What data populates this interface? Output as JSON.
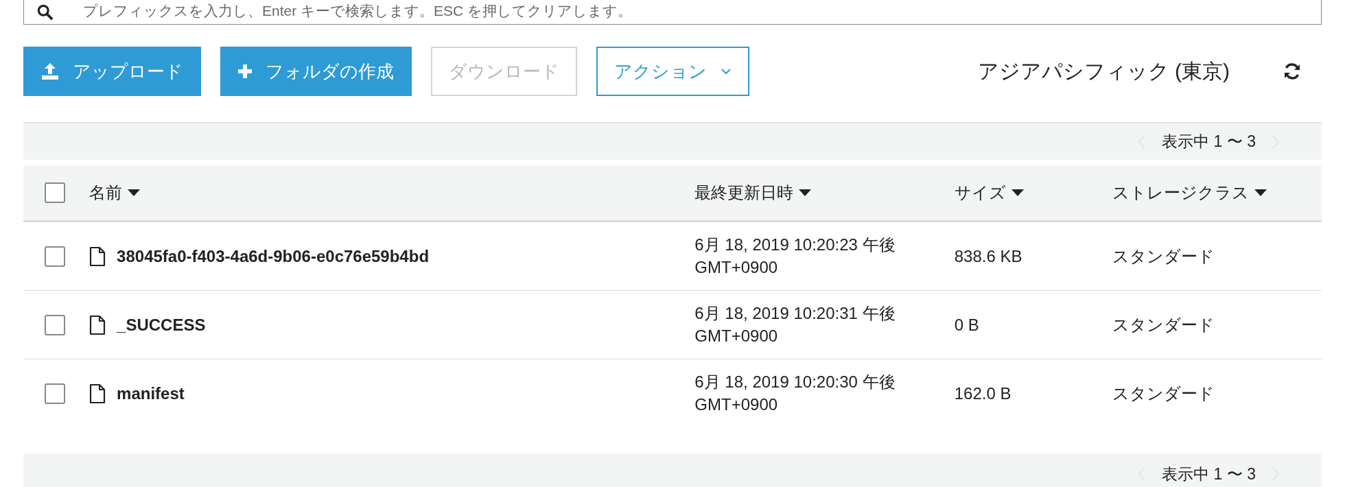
{
  "search": {
    "placeholder": "プレフィックスを入力し、Enter キーで検索します。ESC を押してクリアします。"
  },
  "toolbar": {
    "buttons": [
      {
        "label": "アップロード",
        "kind": "upload",
        "disabled": false
      },
      {
        "label": "フォルダの作成",
        "kind": "folder",
        "disabled": false
      },
      {
        "label": "ダウンロード",
        "kind": "plain",
        "disabled": true
      },
      {
        "label": "アクション",
        "kind": "dropdown",
        "disabled": false
      }
    ],
    "region": "アジアパシフィック (東京)"
  },
  "pagination_top": {
    "text": "表示中 1 〜 3"
  },
  "table": {
    "all_checked": false,
    "columns": [
      "名前",
      "最終更新日時",
      "サイズ",
      "ストレージクラス"
    ],
    "rows": [
      {
        "checked": false,
        "name": "38045fa0-f403-4a6d-9b06-e0c76e59b4bd",
        "modified": [
          "6月 18, 2019 10:20:23 午後",
          "GMT+0900"
        ],
        "size": "838.6 KB",
        "storage_class": "スタンダード"
      },
      {
        "checked": false,
        "name": "_SUCCESS",
        "modified": [
          "6月 18, 2019 10:20:31 午後",
          "GMT+0900"
        ],
        "size": "0 B",
        "storage_class": "スタンダード"
      },
      {
        "checked": false,
        "name": "manifest",
        "modified": [
          "6月 18, 2019 10:20:30 午後",
          "GMT+0900"
        ],
        "size": "162.0 B",
        "storage_class": "スタンダード"
      }
    ]
  },
  "pagination_bottom": {
    "text": "表示中 1 〜 3"
  }
}
